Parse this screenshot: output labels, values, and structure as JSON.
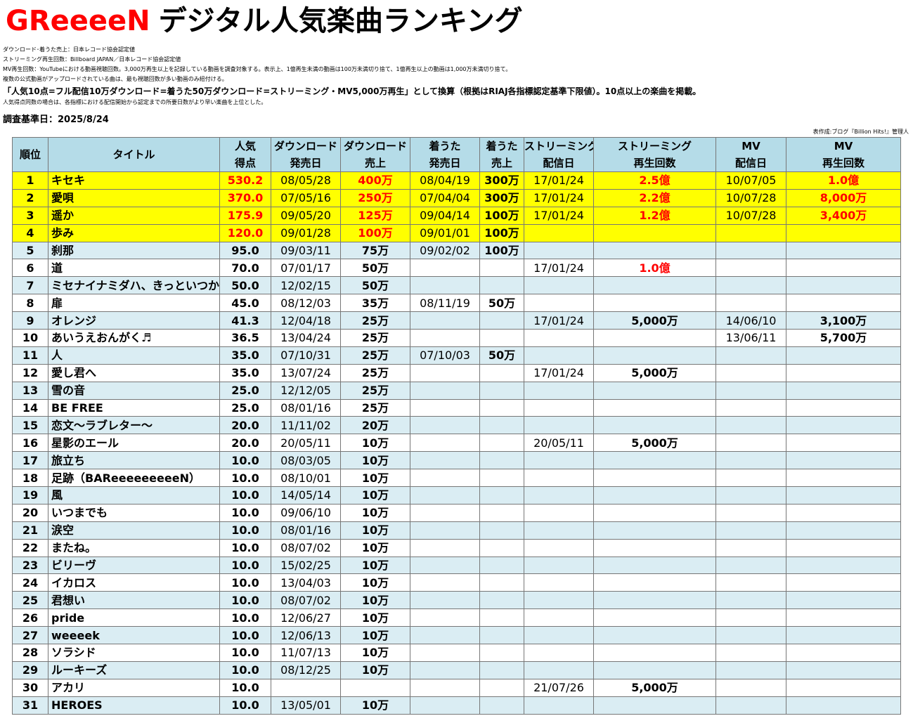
{
  "title": {
    "artist": "GReeeeN",
    "rest": "デジタル人気楽曲ランキング"
  },
  "notes": [
    {
      "text": "ダウンロード･着うた売上：日本レコード協会認定値",
      "style": "small"
    },
    {
      "text": "ストリーミング再生回数：Billboard JAPAN／日本レコード協会認定値",
      "style": "small"
    },
    {
      "text": "MV再生回数：YouTubeにおける動画視聴回数。3,000万再生以上を記録している動画を調査対象する。表示上、1億再生未満の動画は100万未満切り捨て、1億再生以上の動画は1,000万未満切り捨て。",
      "style": "small"
    },
    {
      "text": "複数の公式動画がアップロードされている曲は、最も視聴回数が多い動画のみ紐付ける。",
      "style": "small"
    },
    {
      "text": "「人気10点=フル配信10万ダウンロード=着うた50万ダウンロード=ストリーミング・MV5,000万再生」として換算（根拠はRIAJ各指標認定基準下限値）。10点以上の楽曲を掲載。",
      "style": "bold"
    },
    {
      "text": "人気得点同数の場合は、各指標における配信開始から認定までの所要日数がより早い楽曲を上位とした。",
      "style": "small"
    }
  ],
  "survey_date": "調査基準日：2025/8/24",
  "credit": "表作成:ブログ『Billion Hits!』管理人",
  "columns": [
    {
      "line1": "順位",
      "line2": ""
    },
    {
      "line1": "タイトル",
      "line2": ""
    },
    {
      "line1": "人気",
      "line2": "得点"
    },
    {
      "line1": "ダウンロード",
      "line2": "発売日"
    },
    {
      "line1": "ダウンロード",
      "line2": "売上"
    },
    {
      "line1": "着うた",
      "line2": "発売日"
    },
    {
      "line1": "着うた",
      "line2": "売上"
    },
    {
      "line1": "ストリーミング",
      "line2": "配信日"
    },
    {
      "line1": "ストリーミング",
      "line2": "再生回数"
    },
    {
      "line1": "MV",
      "line2": "配信日"
    },
    {
      "line1": "MV",
      "line2": "再生回数"
    }
  ],
  "colors": {
    "header_bg": "#b5dce8",
    "highlight_bg": "#ffff00",
    "band_bg": "#daedf3",
    "accent_red": "#ff0000"
  },
  "rows": [
    {
      "rank": "1",
      "title": "キセキ",
      "score": "530.2",
      "dl_date": "08/05/28",
      "dl_sales": "400万",
      "ch_date": "08/04/19",
      "ch_sales": "300万",
      "st_date": "17/01/24",
      "st_plays": "2.5億",
      "mv_date": "10/07/05",
      "mv_plays": "1.0億"
    },
    {
      "rank": "2",
      "title": "愛唄",
      "score": "370.0",
      "dl_date": "07/05/16",
      "dl_sales": "250万",
      "ch_date": "07/04/04",
      "ch_sales": "300万",
      "st_date": "17/01/24",
      "st_plays": "2.2億",
      "mv_date": "10/07/28",
      "mv_plays": "8,000万"
    },
    {
      "rank": "3",
      "title": "遥か",
      "score": "175.9",
      "dl_date": "09/05/20",
      "dl_sales": "125万",
      "ch_date": "09/04/14",
      "ch_sales": "100万",
      "st_date": "17/01/24",
      "st_plays": "1.2億",
      "mv_date": "10/07/28",
      "mv_plays": "3,400万"
    },
    {
      "rank": "4",
      "title": "歩み",
      "score": "120.0",
      "dl_date": "09/01/28",
      "dl_sales": "100万",
      "ch_date": "09/01/01",
      "ch_sales": "100万",
      "st_date": "",
      "st_plays": "",
      "mv_date": "",
      "mv_plays": ""
    },
    {
      "rank": "5",
      "title": "刹那",
      "score": "95.0",
      "dl_date": "09/03/11",
      "dl_sales": "75万",
      "ch_date": "09/02/02",
      "ch_sales": "100万",
      "st_date": "",
      "st_plays": "",
      "mv_date": "",
      "mv_plays": ""
    },
    {
      "rank": "6",
      "title": "道",
      "score": "70.0",
      "dl_date": "07/01/17",
      "dl_sales": "50万",
      "ch_date": "",
      "ch_sales": "",
      "st_date": "17/01/24",
      "st_plays": "1.0億",
      "mv_date": "",
      "mv_plays": ""
    },
    {
      "rank": "7",
      "title": "ミセナイナミダハ、きっといつか",
      "score": "50.0",
      "dl_date": "12/02/15",
      "dl_sales": "50万",
      "ch_date": "",
      "ch_sales": "",
      "st_date": "",
      "st_plays": "",
      "mv_date": "",
      "mv_plays": ""
    },
    {
      "rank": "8",
      "title": "扉",
      "score": "45.0",
      "dl_date": "08/12/03",
      "dl_sales": "35万",
      "ch_date": "08/11/19",
      "ch_sales": "50万",
      "st_date": "",
      "st_plays": "",
      "mv_date": "",
      "mv_plays": ""
    },
    {
      "rank": "9",
      "title": "オレンジ",
      "score": "41.3",
      "dl_date": "12/04/18",
      "dl_sales": "25万",
      "ch_date": "",
      "ch_sales": "",
      "st_date": "17/01/24",
      "st_plays": "5,000万",
      "mv_date": "14/06/10",
      "mv_plays": "3,100万"
    },
    {
      "rank": "10",
      "title": "あいうえおんがく♬",
      "score": "36.5",
      "dl_date": "13/04/24",
      "dl_sales": "25万",
      "ch_date": "",
      "ch_sales": "",
      "st_date": "",
      "st_plays": "",
      "mv_date": "13/06/11",
      "mv_plays": "5,700万"
    },
    {
      "rank": "11",
      "title": "人",
      "score": "35.0",
      "dl_date": "07/10/31",
      "dl_sales": "25万",
      "ch_date": "07/10/03",
      "ch_sales": "50万",
      "st_date": "",
      "st_plays": "",
      "mv_date": "",
      "mv_plays": ""
    },
    {
      "rank": "12",
      "title": "愛し君へ",
      "score": "35.0",
      "dl_date": "13/07/24",
      "dl_sales": "25万",
      "ch_date": "",
      "ch_sales": "",
      "st_date": "17/01/24",
      "st_plays": "5,000万",
      "mv_date": "",
      "mv_plays": ""
    },
    {
      "rank": "13",
      "title": "雪の音",
      "score": "25.0",
      "dl_date": "12/12/05",
      "dl_sales": "25万",
      "ch_date": "",
      "ch_sales": "",
      "st_date": "",
      "st_plays": "",
      "mv_date": "",
      "mv_plays": ""
    },
    {
      "rank": "14",
      "title": "BE FREE",
      "score": "25.0",
      "dl_date": "08/01/16",
      "dl_sales": "25万",
      "ch_date": "",
      "ch_sales": "",
      "st_date": "",
      "st_plays": "",
      "mv_date": "",
      "mv_plays": ""
    },
    {
      "rank": "15",
      "title": "恋文～ラブレター～",
      "score": "20.0",
      "dl_date": "11/11/02",
      "dl_sales": "20万",
      "ch_date": "",
      "ch_sales": "",
      "st_date": "",
      "st_plays": "",
      "mv_date": "",
      "mv_plays": ""
    },
    {
      "rank": "16",
      "title": "星影のエール",
      "score": "20.0",
      "dl_date": "20/05/11",
      "dl_sales": "10万",
      "ch_date": "",
      "ch_sales": "",
      "st_date": "20/05/11",
      "st_plays": "5,000万",
      "mv_date": "",
      "mv_plays": ""
    },
    {
      "rank": "17",
      "title": "旅立ち",
      "score": "10.0",
      "dl_date": "08/03/05",
      "dl_sales": "10万",
      "ch_date": "",
      "ch_sales": "",
      "st_date": "",
      "st_plays": "",
      "mv_date": "",
      "mv_plays": ""
    },
    {
      "rank": "18",
      "title": "足跡（BAReeeeeeeeeN）",
      "score": "10.0",
      "dl_date": "08/10/01",
      "dl_sales": "10万",
      "ch_date": "",
      "ch_sales": "",
      "st_date": "",
      "st_plays": "",
      "mv_date": "",
      "mv_plays": ""
    },
    {
      "rank": "19",
      "title": "風",
      "score": "10.0",
      "dl_date": "14/05/14",
      "dl_sales": "10万",
      "ch_date": "",
      "ch_sales": "",
      "st_date": "",
      "st_plays": "",
      "mv_date": "",
      "mv_plays": ""
    },
    {
      "rank": "20",
      "title": "いつまでも",
      "score": "10.0",
      "dl_date": "09/06/10",
      "dl_sales": "10万",
      "ch_date": "",
      "ch_sales": "",
      "st_date": "",
      "st_plays": "",
      "mv_date": "",
      "mv_plays": ""
    },
    {
      "rank": "21",
      "title": "涙空",
      "score": "10.0",
      "dl_date": "08/01/16",
      "dl_sales": "10万",
      "ch_date": "",
      "ch_sales": "",
      "st_date": "",
      "st_plays": "",
      "mv_date": "",
      "mv_plays": ""
    },
    {
      "rank": "22",
      "title": "またね。",
      "score": "10.0",
      "dl_date": "08/07/02",
      "dl_sales": "10万",
      "ch_date": "",
      "ch_sales": "",
      "st_date": "",
      "st_plays": "",
      "mv_date": "",
      "mv_plays": ""
    },
    {
      "rank": "23",
      "title": "ビリーヴ",
      "score": "10.0",
      "dl_date": "15/02/25",
      "dl_sales": "10万",
      "ch_date": "",
      "ch_sales": "",
      "st_date": "",
      "st_plays": "",
      "mv_date": "",
      "mv_plays": ""
    },
    {
      "rank": "24",
      "title": "イカロス",
      "score": "10.0",
      "dl_date": "13/04/03",
      "dl_sales": "10万",
      "ch_date": "",
      "ch_sales": "",
      "st_date": "",
      "st_plays": "",
      "mv_date": "",
      "mv_plays": ""
    },
    {
      "rank": "25",
      "title": "君想い",
      "score": "10.0",
      "dl_date": "08/07/02",
      "dl_sales": "10万",
      "ch_date": "",
      "ch_sales": "",
      "st_date": "",
      "st_plays": "",
      "mv_date": "",
      "mv_plays": ""
    },
    {
      "rank": "26",
      "title": "pride",
      "score": "10.0",
      "dl_date": "12/06/27",
      "dl_sales": "10万",
      "ch_date": "",
      "ch_sales": "",
      "st_date": "",
      "st_plays": "",
      "mv_date": "",
      "mv_plays": ""
    },
    {
      "rank": "27",
      "title": "weeeek",
      "score": "10.0",
      "dl_date": "12/06/13",
      "dl_sales": "10万",
      "ch_date": "",
      "ch_sales": "",
      "st_date": "",
      "st_plays": "",
      "mv_date": "",
      "mv_plays": ""
    },
    {
      "rank": "28",
      "title": "ソラシド",
      "score": "10.0",
      "dl_date": "11/07/13",
      "dl_sales": "10万",
      "ch_date": "",
      "ch_sales": "",
      "st_date": "",
      "st_plays": "",
      "mv_date": "",
      "mv_plays": ""
    },
    {
      "rank": "29",
      "title": "ルーキーズ",
      "score": "10.0",
      "dl_date": "08/12/25",
      "dl_sales": "10万",
      "ch_date": "",
      "ch_sales": "",
      "st_date": "",
      "st_plays": "",
      "mv_date": "",
      "mv_plays": ""
    },
    {
      "rank": "30",
      "title": "アカリ",
      "score": "10.0",
      "dl_date": "",
      "dl_sales": "",
      "ch_date": "",
      "ch_sales": "",
      "st_date": "21/07/26",
      "st_plays": "5,000万",
      "mv_date": "",
      "mv_plays": ""
    },
    {
      "rank": "31",
      "title": "HEROES",
      "score": "10.0",
      "dl_date": "13/05/01",
      "dl_sales": "10万",
      "ch_date": "",
      "ch_sales": "",
      "st_date": "",
      "st_plays": "",
      "mv_date": "",
      "mv_plays": ""
    }
  ]
}
